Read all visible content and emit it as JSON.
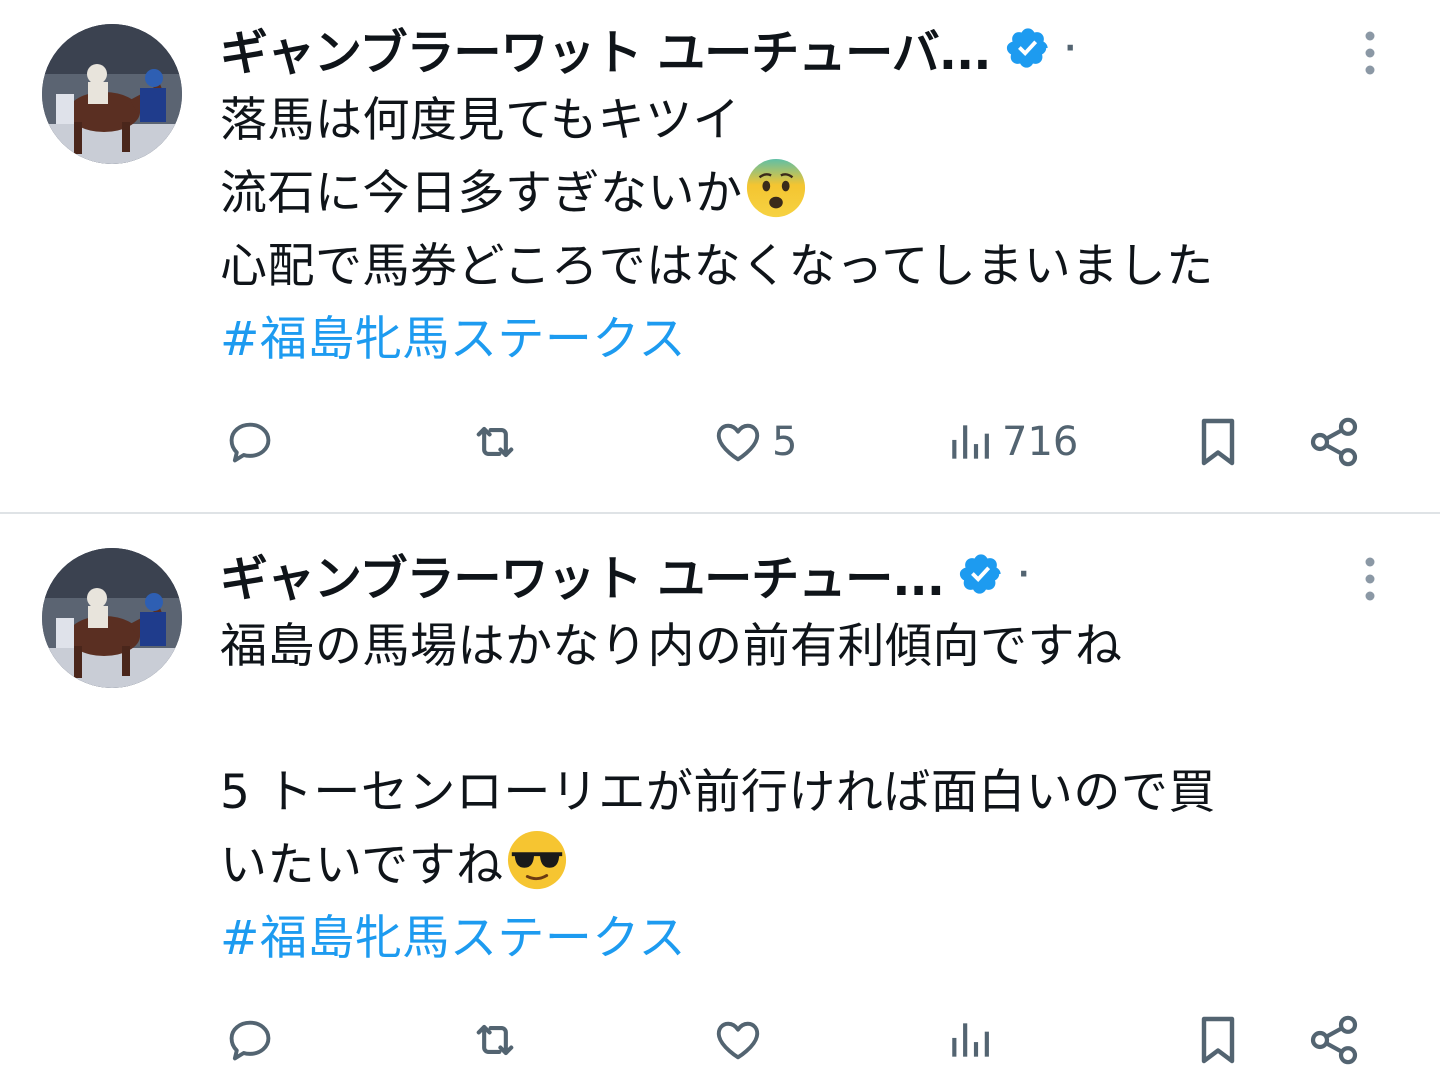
{
  "tweets": [
    {
      "display_name": "ギャンブラーワット ユーチューバ...",
      "separator": "·",
      "body_lines": [
        "落馬は何度見てもキツイ",
        "流石に今日多すぎないか",
        "心配で馬券どころではなくなってしまいました"
      ],
      "hashtag": "#福島牝馬ステークス",
      "emoji": "anxious-face",
      "likes": "5",
      "views": "716"
    },
    {
      "display_name": "ギャンブラーワット ユーチュー...",
      "separator": "·",
      "body_lines": [
        "福島の馬場はかなり内の前有利傾向ですね",
        "",
        "5 トーセンローリエが前行ければ面白いので買",
        "いたいですね"
      ],
      "hashtag": "#福島牝馬ステークス",
      "emoji": "sunglasses-face"
    }
  ],
  "colors": {
    "accent": "#1d9bf0",
    "text": "#0f1419",
    "muted": "#536471",
    "divider": "#dfe3e6"
  },
  "icons": {
    "verified": "verified-badge-icon",
    "more": "more-vertical-icon",
    "reply": "reply-icon",
    "retweet": "retweet-icon",
    "like": "heart-icon",
    "views": "views-chart-icon",
    "bookmark": "bookmark-icon",
    "share": "share-icon"
  }
}
